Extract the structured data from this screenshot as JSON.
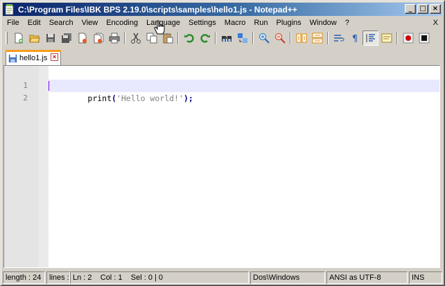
{
  "window": {
    "title": "C:\\Program Files\\IBK BPS 2.19.0\\scripts\\samples\\hello1.js - Notepad++",
    "minimize_glyph": "_",
    "maximize_glyph": "□",
    "close_glyph": "×"
  },
  "menubar": {
    "items": [
      "File",
      "Edit",
      "Search",
      "View",
      "Encoding",
      "Language",
      "Settings",
      "Macro",
      "Run",
      "Plugins",
      "Window",
      "?"
    ],
    "close_label": "X"
  },
  "toolbar": {
    "icons": [
      "new-file-icon",
      "open-file-icon",
      "save-icon",
      "save-all-icon",
      "close-icon",
      "close-all-icon",
      "print-icon",
      "cut-icon",
      "copy-icon",
      "paste-icon",
      "undo-icon",
      "redo-icon",
      "find-icon",
      "replace-icon",
      "zoom-in-icon",
      "zoom-out-icon",
      "sync-v-icon",
      "sync-h-icon",
      "word-wrap-icon",
      "show-all-chars-icon",
      "indent-guide-icon",
      "user-lang-icon",
      "record-macro-icon",
      "stop-macro-icon"
    ]
  },
  "tabs": [
    {
      "label": "hello1.js",
      "active": true,
      "close_glyph": "×"
    }
  ],
  "editor": {
    "lines": [
      {
        "number": "1",
        "fn": "print",
        "open": "(",
        "string": "'Hello world!'",
        "close": ");"
      },
      {
        "number": "2",
        "fn": "",
        "open": "",
        "string": "",
        "close": ""
      }
    ],
    "current_line": 2
  },
  "statusbar": {
    "length": "length : 24",
    "lines": "lines :",
    "position": "Ln : 2    Col : 1    Sel : 0 | 0",
    "eol": "Dos\\Windows",
    "encoding": "ANSI as UTF-8",
    "mode": "INS"
  },
  "colors": {
    "title_start": "#0a246a",
    "title_end": "#a6caf0",
    "current_line_bg": "#e8e8ff",
    "tab_accent": "#fa9c1a",
    "string_color": "#808080"
  }
}
